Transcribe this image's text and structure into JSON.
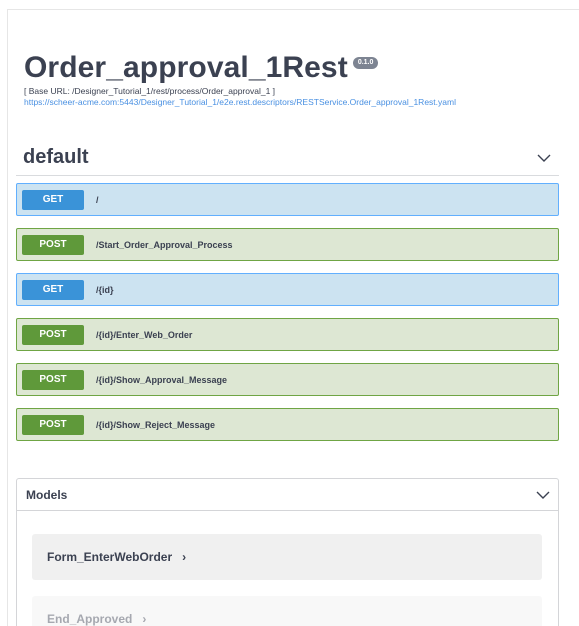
{
  "info": {
    "title": "Order_approval_1Rest",
    "version": "0.1.0",
    "base_url": "[ Base URL: /Designer_Tutorial_1/rest/process/Order_approval_1 ]",
    "spec_url": "https://scheer-acme.com:5443/Designer_Tutorial_1/e2e.rest.descriptors/RESTService.Order_approval_1Rest.yaml"
  },
  "tag": {
    "name": "default",
    "toggle_icon": "chevron-down-icon"
  },
  "operations": [
    {
      "method": "GET",
      "path": "/"
    },
    {
      "method": "POST",
      "path": "/Start_Order_Approval_Process"
    },
    {
      "method": "GET",
      "path": "/{id}"
    },
    {
      "method": "POST",
      "path": "/{id}/Enter_Web_Order"
    },
    {
      "method": "POST",
      "path": "/{id}/Show_Approval_Message"
    },
    {
      "method": "POST",
      "path": "/{id}/Show_Reject_Message"
    }
  ],
  "models": {
    "title": "Models",
    "toggle_icon": "chevron-down-icon",
    "items": [
      {
        "name": "Form_EnterWebOrder",
        "arrow": "›"
      },
      {
        "name": "End_Approved",
        "arrow": "›"
      }
    ]
  },
  "colors": {
    "get_accent": "#3a93d8",
    "get_bg": "#cce3f1",
    "post_accent": "#5f993a",
    "post_bg": "#dde7d3",
    "link": "#4990e2"
  }
}
